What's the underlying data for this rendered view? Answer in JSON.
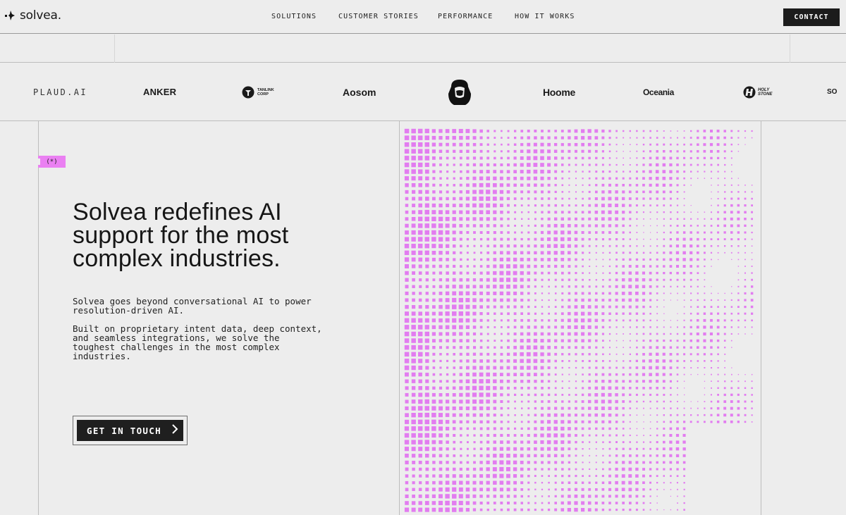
{
  "header": {
    "brand": "solvea.",
    "nav": [
      {
        "label": "SOLUTIONS",
        "name": "nav-solutions"
      },
      {
        "label": "CUSTOMER STORIES",
        "name": "nav-customer-stories"
      },
      {
        "label": "PERFORMANCE",
        "name": "nav-performance"
      },
      {
        "label": "HOW IT WORKS",
        "name": "nav-how-it-works"
      }
    ],
    "contact_label": "CONTACT"
  },
  "logos": [
    {
      "name": "plaud-ai-logo",
      "text": "PLAUD.AI"
    },
    {
      "name": "anker-logo",
      "text": "ANKER"
    },
    {
      "name": "tanlink-corp-logo",
      "text": "TANLINK CORP"
    },
    {
      "name": "aosom-logo",
      "text": "Aosom"
    },
    {
      "name": "hooded-figure-logo",
      "text": ""
    },
    {
      "name": "hoome-logo",
      "text": "Hoome"
    },
    {
      "name": "oceania-logo",
      "text": "Oceania"
    },
    {
      "name": "holy-stone-logo",
      "text": "HOLY STONE"
    },
    {
      "name": "partial-logo",
      "text": "SO"
    }
  ],
  "hero": {
    "tag": "(*)",
    "headline": "Solvea redefines AI support for the most complex industries.",
    "paragraph1": "Solvea goes beyond conversational AI to power resolution-driven AI.",
    "paragraph2": "Built on proprietary intent data, deep context, and seamless integrations, we solve the toughest challenges in the most complex industries.",
    "cta_label": "GET IN TOUCH",
    "cta_icon": "chevron-right-icon"
  },
  "colors": {
    "background": "#ededed",
    "accent_pink": "#ea80f2",
    "dark": "#1c1c1c",
    "dots": "#e27cf0"
  }
}
